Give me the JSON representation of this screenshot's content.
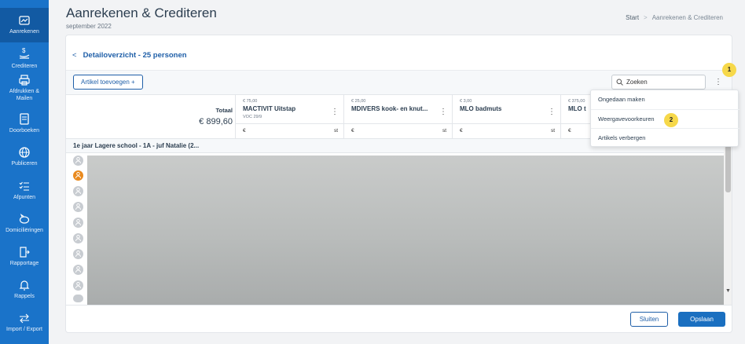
{
  "sidebar": {
    "items": [
      {
        "label": "Aanrekenen",
        "icon": "invoice-icon"
      },
      {
        "label": "Crediteren",
        "icon": "credit-icon"
      },
      {
        "label": "Afdrukken &",
        "label2": "Mailen",
        "icon": "printer-icon"
      },
      {
        "label": "Doorboeken",
        "icon": "ledger-icon"
      },
      {
        "label": "Publiceren",
        "icon": "globe-icon"
      },
      {
        "label": "Afpunten",
        "icon": "checklist-icon"
      },
      {
        "label": "Domiciliëringen",
        "icon": "piggy-bank-icon"
      },
      {
        "label": "Rapportage",
        "icon": "report-icon"
      },
      {
        "label": "Rappels",
        "icon": "bell-icon"
      },
      {
        "label": "Import / Export",
        "icon": "transfer-icon"
      }
    ]
  },
  "header": {
    "title": "Aanrekenen & Crediteren",
    "subtitle": "september 2022",
    "breadcrumb": {
      "home": "Start",
      "separator": ">",
      "current": "Aanrekenen & Crediteren"
    }
  },
  "detail": {
    "back": "<",
    "title": "Detailoverzicht - 25 personen"
  },
  "toolbar": {
    "add_label": "Artikel toevoegen +",
    "search_value": "Zoeken",
    "more": "⋮",
    "badge1": "1",
    "badge2": "2"
  },
  "table": {
    "total_label": "Totaal",
    "total_value": "€ 899,60",
    "columns": [
      {
        "price": "€ 75,00",
        "name": "MACTIVIT Uitstap",
        "code": "VOC 29/9",
        "eur": "€",
        "st": "st"
      },
      {
        "price": "€ 25,00",
        "name": "MDIVERS kook- en knut...",
        "code": "",
        "eur": "€",
        "st": "st"
      },
      {
        "price": "€ 3,00",
        "name": "MLO badmuts",
        "code": "",
        "eur": "€",
        "st": "st"
      },
      {
        "price": "€ 375,00",
        "name": "MLO t",
        "code": "",
        "eur": "€",
        "st": ""
      }
    ],
    "column_menu": "⋮",
    "group_label": "1e jaar Lagere school - 1A - juf Natalie (2..."
  },
  "menu": {
    "items": [
      "Ongedaan maken",
      "Weergavevoorkeuren",
      "Artikels verbergen"
    ]
  },
  "footer": {
    "close_label": "Sluiten",
    "save_label": "Opslaan"
  },
  "colors": {
    "sidebar": "#1a73c9",
    "primary": "#1a6fc0",
    "badge": "#f6d84a",
    "selected_avatar": "#e98a1e"
  }
}
